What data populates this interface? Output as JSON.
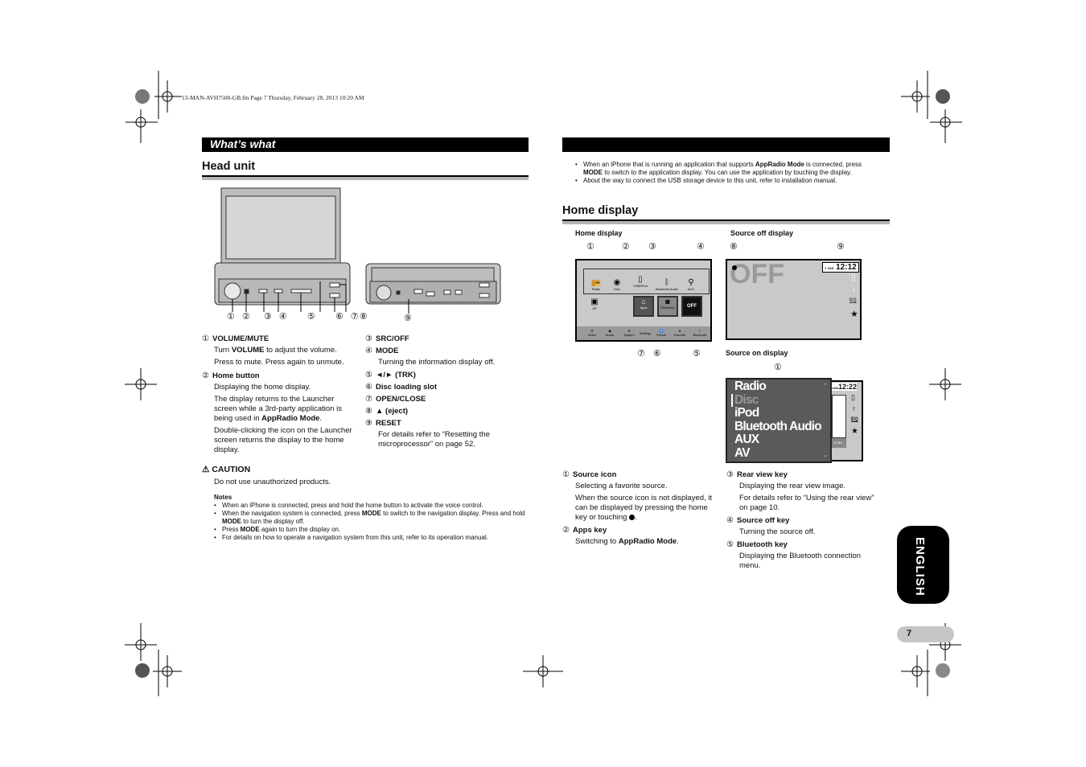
{
  "print_header": "13-MAN-AVH7500-GB.fm  Page 7  Thursday, February 28, 2013  10:20 AM",
  "left": {
    "section_title": "What’s what",
    "heading": "Head unit",
    "callouts_front": [
      "①",
      "②",
      "③",
      "④",
      "⑤",
      "⑥",
      "⑦",
      "⑧"
    ],
    "callouts_detached": [
      "⑨"
    ],
    "items_col1": [
      {
        "num": "①",
        "title": "VOLUME/MUTE",
        "paras": [
          {
            "pre": "Turn ",
            "bold": "VOLUME",
            "post": " to adjust the volume."
          },
          {
            "pre": "Press to mute. Press again to unmute.",
            "bold": "",
            "post": ""
          }
        ]
      },
      {
        "num": "②",
        "title": "Home button",
        "paras": [
          {
            "pre": "Displaying the home display.",
            "bold": "",
            "post": ""
          },
          {
            "pre": "The display returns to the Launcher screen while a 3rd-party application is being used in ",
            "bold": "AppRadio Mode",
            "post": "."
          },
          {
            "pre": "Double-clicking the icon on the Launcher screen returns the display to the home display.",
            "bold": "",
            "post": ""
          }
        ]
      }
    ],
    "items_col2": [
      {
        "num": "③",
        "title": "SRC/OFF",
        "desc": ""
      },
      {
        "num": "④",
        "title": "MODE",
        "desc": "Turning the information display off."
      },
      {
        "num": "⑤",
        "title": "◄/► (TRK)",
        "desc": ""
      },
      {
        "num": "⑥",
        "title": "Disc loading slot",
        "desc": ""
      },
      {
        "num": "⑦",
        "title": "OPEN/CLOSE",
        "desc": ""
      },
      {
        "num": "⑧",
        "title": "▲ (eject)",
        "desc": ""
      },
      {
        "num": "⑨",
        "title": "RESET",
        "desc": "For details refer to “Resetting the microprocessor” on page 52."
      }
    ],
    "caution": {
      "icon": "warning-triangle-icon",
      "title": "CAUTION",
      "text": "Do not use unauthorized products."
    },
    "notes": {
      "title": "Notes",
      "items": [
        {
          "pre": "When an iPhone is connected, press and hold the home button to activate the voice control.",
          "bold": "",
          "post": "",
          "bold2": "",
          "post2": ""
        },
        {
          "pre": "When the navigation system is connected, press ",
          "bold": "MODE",
          "post": " to switch to the navigation display. Press and hold ",
          "bold2": "MODE",
          "post2": " to turn the display off."
        },
        {
          "pre": "Press ",
          "bold": "MODE",
          "post": " again to turn the display on.",
          "bold2": "",
          "post2": ""
        },
        {
          "pre": "For details on how to operate a navigation system from this unit, refer to its operation manual.",
          "bold": "",
          "post": "",
          "bold2": "",
          "post2": ""
        }
      ]
    }
  },
  "right": {
    "section_title": "",
    "intro_bullets": [
      {
        "pre": "When an iPhone that is running an application that supports ",
        "bold": "AppRadio Mode",
        "post": " is connected, press ",
        "bold2": "MODE",
        "post2": " to switch to the application display. You can use the application by touching the display."
      },
      {
        "pre": "About the way to connect the USB storage device to this unit, refer to installation manual.",
        "bold": "",
        "post": "",
        "bold2": "",
        "post2": ""
      }
    ],
    "heading": "Home display",
    "home_display": {
      "caption": "Home display",
      "top_callouts": [
        "①",
        "②",
        "③",
        "④"
      ],
      "bottom_callouts": [
        "⑦",
        "⑥",
        "⑤"
      ],
      "sources": [
        "Radio",
        "Disc",
        "USB/iPod",
        "Bluetooth Audio",
        "AUX",
        "AV"
      ],
      "keys": {
        "apps": "Apps",
        "rear_view": "RearView",
        "rear_view_sub": "ON",
        "off": "OFF"
      },
      "bottom_bar": [
        "Video",
        "Audio",
        "System",
        "Settings",
        "Theme",
        "Favorite",
        "Bluetooth"
      ]
    },
    "source_off_display": {
      "caption": "Source off display",
      "callouts": [
        "⑧",
        "⑨"
      ],
      "big_text": "OFF",
      "date": "1 JAN",
      "ampm": "AM",
      "time": "12:12",
      "eq": "EQ"
    },
    "source_on_display": {
      "caption": "Source on display",
      "callout": "①",
      "list": [
        "Radio",
        "Disc",
        "iPod",
        "Bluetooth Audio",
        "AUX",
        "AV"
      ],
      "selected": "Disc",
      "date": "JAN",
      "ampm": "AM",
      "time": "12:22",
      "eq": "EQ",
      "side_tab": "S.Rtrv"
    },
    "items_col1": [
      {
        "num": "①",
        "title": "Source icon",
        "paras": [
          {
            "pre": "Selecting a favorite source.",
            "bold": "",
            "post": ""
          },
          {
            "pre": "When the source icon is not displayed, it can be displayed by pressing the home key or touching ",
            "bold": "",
            "post": "."
          }
        ]
      },
      {
        "num": "②",
        "title": "Apps key",
        "paras": [
          {
            "pre": "Switching to ",
            "bold": "AppRadio Mode",
            "post": "."
          }
        ]
      }
    ],
    "items_col2": [
      {
        "num": "③",
        "title": "Rear view key",
        "paras": [
          "Displaying the rear view image.",
          "For details refer to “Using the rear view” on page 10."
        ]
      },
      {
        "num": "④",
        "title": "Source off key",
        "paras": [
          "Turning the source off."
        ]
      },
      {
        "num": "⑤",
        "title": "Bluetooth key",
        "paras": [
          "Displaying the Bluetooth connection menu."
        ]
      }
    ]
  },
  "side_tab": "ENGLISH",
  "page_number": "7"
}
